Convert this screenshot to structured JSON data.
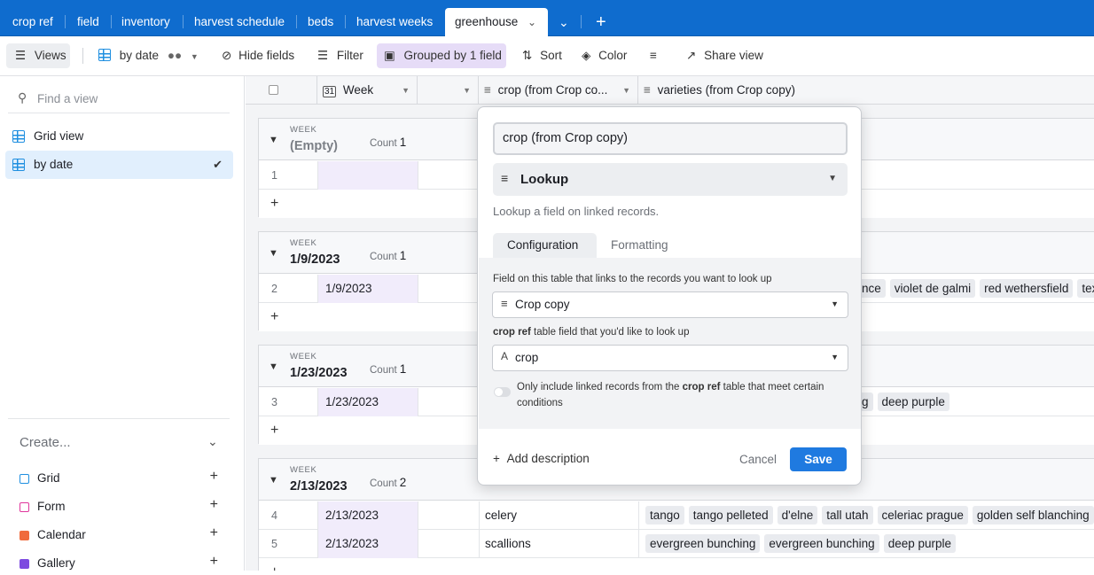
{
  "tabs": [
    "crop ref",
    "field",
    "inventory",
    "harvest schedule",
    "beds",
    "harvest weeks"
  ],
  "active_tab": "greenhouse",
  "toolbar": {
    "views": "Views",
    "view_name": "by date",
    "hide_fields": "Hide fields",
    "filter": "Filter",
    "grouped": "Grouped by 1 field",
    "sort": "Sort",
    "color": "Color",
    "share": "Share view"
  },
  "sidebar": {
    "find_placeholder": "Find a view",
    "views": [
      {
        "label": "Grid view"
      },
      {
        "label": "by date"
      }
    ],
    "create_title": "Create...",
    "create_items": [
      {
        "label": "Grid",
        "color": "#1f8fe0"
      },
      {
        "label": "Form",
        "color": "#e0369c"
      },
      {
        "label": "Calendar",
        "color": "#f06b3c"
      },
      {
        "label": "Gallery",
        "color": "#7d4be0"
      }
    ]
  },
  "grid": {
    "columns": [
      "Week",
      "crop (from Crop co...",
      "varieties (from Crop copy)"
    ],
    "groups": [
      {
        "label": "WEEK",
        "value": "(Empty)",
        "count_label": "Count",
        "count": "1",
        "rows": [
          {
            "num": "1",
            "week": "",
            "crop": "",
            "varieties": []
          }
        ]
      },
      {
        "label": "WEEK",
        "value": "1/9/2023",
        "count_label": "Count",
        "count": "1",
        "rows": [
          {
            "num": "2",
            "week": "1/9/2023",
            "crop": "",
            "varieties": [
              "nce",
              "violet de galmi",
              "red wethersfield",
              "texa"
            ]
          }
        ]
      },
      {
        "label": "WEEK",
        "value": "1/23/2023",
        "count_label": "Count",
        "count": "1",
        "rows": [
          {
            "num": "3",
            "week": "1/23/2023",
            "crop": "",
            "varieties": [
              "g",
              "deep purple"
            ]
          }
        ]
      },
      {
        "label": "WEEK",
        "value": "2/13/2023",
        "count_label": "Count",
        "count": "2",
        "rows": [
          {
            "num": "4",
            "week": "2/13/2023",
            "crop": "celery",
            "varieties": [
              "tango",
              "tango pelleted",
              "d'elne",
              "tall utah",
              "celeriac prague",
              "golden self blanching"
            ]
          },
          {
            "num": "5",
            "week": "2/13/2023",
            "crop": "scallions",
            "varieties": [
              "evergreen bunching",
              "evergreen bunching",
              "deep purple"
            ]
          }
        ]
      }
    ]
  },
  "popup": {
    "field_name": "crop (from Crop copy)",
    "field_type": "Lookup",
    "description": "Lookup a field on linked records.",
    "tab_config": "Configuration",
    "tab_format": "Formatting",
    "link_label": "Field on this table that links to the records you want to look up",
    "link_value": "Crop copy",
    "lookup_label_bold": "crop ref",
    "lookup_label_rest": " table field that you'd like to look up",
    "lookup_value": "crop",
    "toggle_text_1": "Only include linked records from the ",
    "toggle_text_bold": "crop ref",
    "toggle_text_2": " table that meet certain conditions",
    "add_description": "Add description",
    "cancel": "Cancel",
    "save": "Save"
  }
}
